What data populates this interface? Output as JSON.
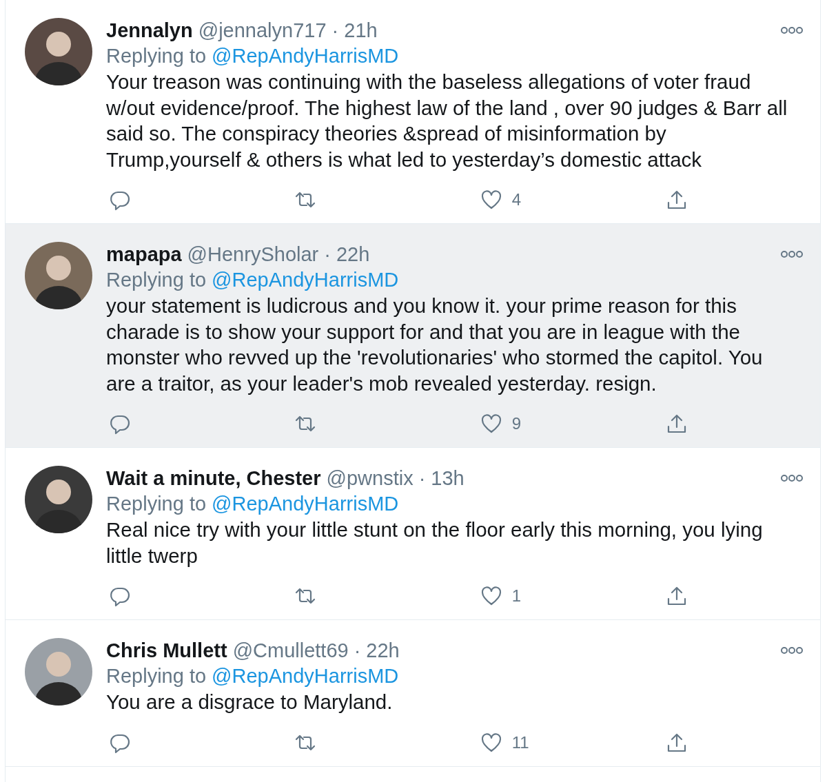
{
  "tweets": [
    {
      "name": "Jennalyn",
      "handle": "@jennalyn717",
      "separator": "·",
      "time": "21h",
      "highlighted": false,
      "replying_label": "Replying to",
      "replying_to": "@RepAndyHarrisMD",
      "text": "Your treason was continuing with the baseless allegations of voter fraud w/out evidence/proof. The highest law of the land , over 90 judges & Barr all said so. The conspiracy theories &spread of misinformation by Trump,yourself & others is what led to yesterday’s domestic attack",
      "likes": "4"
    },
    {
      "name": "mapapa",
      "handle": "@HenrySholar",
      "separator": "·",
      "time": "22h",
      "highlighted": true,
      "replying_label": "Replying to",
      "replying_to": "@RepAndyHarrisMD",
      "text": "your statement is ludicrous and you know it. your prime reason for this charade is to show your support for and that you are in league with the monster who revved up the 'revolutionaries' who stormed the capitol. You are a traitor, as your leader's mob revealed yesterday. resign.",
      "likes": "9"
    },
    {
      "name": "Wait a minute, Chester",
      "handle": "@pwnstix",
      "separator": "·",
      "time": "13h",
      "highlighted": false,
      "replying_label": "Replying to",
      "replying_to": "@RepAndyHarrisMD",
      "text": "Real nice try with your little stunt on the floor early this morning, you lying little twerp",
      "likes": "1"
    },
    {
      "name": "Chris Mullett",
      "handle": "@Cmullett69",
      "separator": "·",
      "time": "22h",
      "highlighted": false,
      "replying_label": "Replying to",
      "replying_to": "@RepAndyHarrisMD",
      "text": "You are a disgrace to Maryland.",
      "likes": "11"
    }
  ]
}
